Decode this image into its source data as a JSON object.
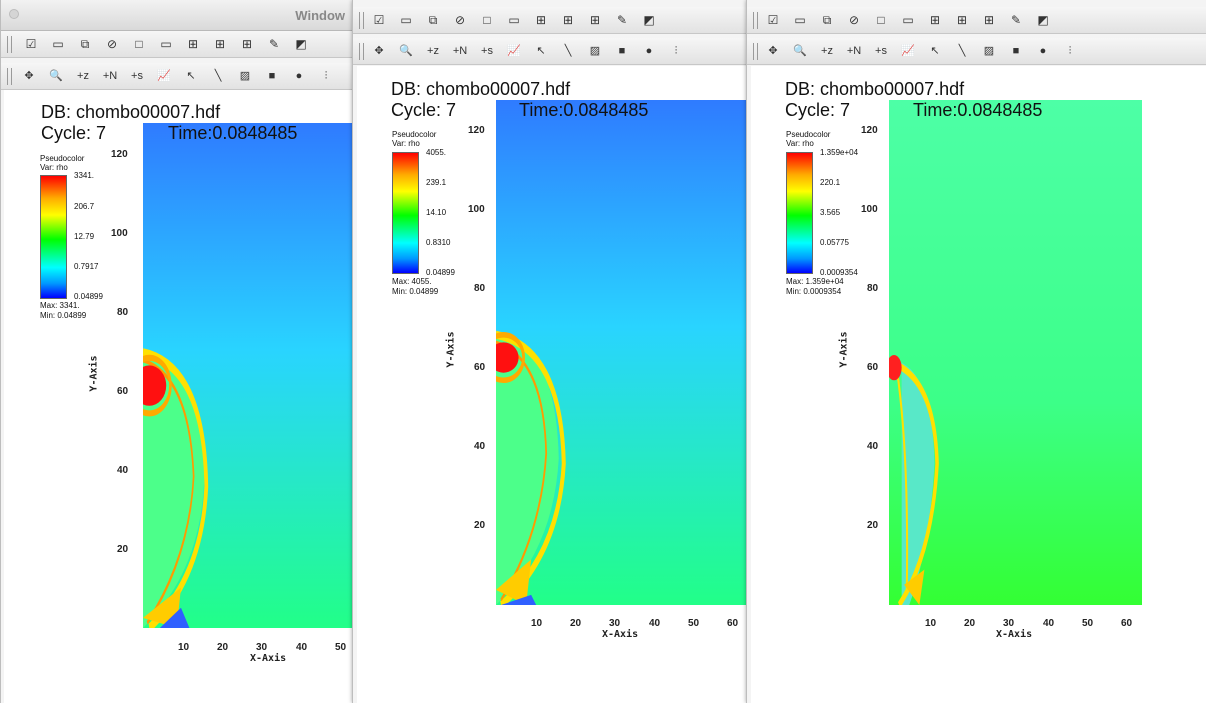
{
  "windows": [
    {
      "title": "Window",
      "db": "DB: chombo00007.hdf",
      "cycle": "Cycle: 7",
      "time": "Time:0.0848485",
      "legend": {
        "title": "Pseudocolor",
        "var": "Var: rho",
        "levels": [
          "3341.",
          "206.7",
          "12.79",
          "0.7917",
          "0.04899"
        ],
        "max": "Max:  3341.",
        "min": "Min:  0.04899"
      },
      "yticks": [
        "120",
        "100",
        "80",
        "60",
        "40",
        "20"
      ],
      "xticks": [
        "10",
        "20",
        "30",
        "40",
        "50"
      ],
      "xlabel": "X-Axis",
      "ylabel": "Y-Axis"
    },
    {
      "title": "",
      "db": "DB: chombo00007.hdf",
      "cycle": "Cycle: 7",
      "time": "Time:0.0848485",
      "legend": {
        "title": "Pseudocolor",
        "var": "Var: rho",
        "levels": [
          "4055.",
          "239.1",
          "14.10",
          "0.8310",
          "0.04899"
        ],
        "max": "Max:  4055.",
        "min": "Min:  0.04899"
      },
      "yticks": [
        "120",
        "100",
        "80",
        "60",
        "40",
        "20"
      ],
      "xticks": [
        "10",
        "20",
        "30",
        "40",
        "50",
        "60"
      ],
      "xlabel": "X-Axis",
      "ylabel": "Y-Axis"
    },
    {
      "title": "",
      "db": "DB: chombo00007.hdf",
      "cycle": "Cycle: 7",
      "time": "Time:0.0848485",
      "legend": {
        "title": "Pseudocolor",
        "var": "Var: rho",
        "levels": [
          "1.359e+04",
          "220.1",
          "3.565",
          "0.05775",
          "0.0009354"
        ],
        "max": "Max:  1.359e+04",
        "min": "Min:  0.0009354"
      },
      "yticks": [
        "120",
        "100",
        "80",
        "60",
        "40",
        "20"
      ],
      "xticks": [
        "10",
        "20",
        "30",
        "40",
        "50",
        "60"
      ],
      "xlabel": "X-Axis",
      "ylabel": "Y-Axis"
    }
  ],
  "toolbar_icons": [
    "new-window-icon",
    "delete-window-icon",
    "clone-window-icon",
    "clear-window-icon",
    "layout-1x1-icon",
    "layout-1x2-icon",
    "layout-2x2-icon",
    "layout-2x3-icon",
    "layout-3x3-icon",
    "lock-view-icon",
    "invert-colors-icon"
  ],
  "mode_icons": [
    "navigate-icon",
    "zoom-icon",
    "zone-pick-icon",
    "node-pick-icon",
    "spreadsheet-pick-icon",
    "lineout-icon",
    "pick-icon",
    "line-icon",
    "plane-icon",
    "box-icon",
    "sphere-icon",
    "point-tool-icon"
  ],
  "toolbar_glyphs": [
    "☑",
    "▭",
    "⧉",
    "⊘",
    "□",
    "▭",
    "⊞",
    "⊞",
    "⊞",
    "✎",
    "◩"
  ],
  "mode_glyphs": [
    "✥",
    "🔍",
    "+z",
    "+N",
    "+s",
    "📈",
    "↖",
    "╲",
    "▨",
    "■",
    "●",
    "⫶"
  ],
  "colors": {
    "bg_ambient": "#29d4ff",
    "bg_top": "#2f7bff",
    "bg_bottom": "#22ff77",
    "field_green": "#4cff8a",
    "shock": "#ffe000",
    "hot": "#ff1010"
  }
}
